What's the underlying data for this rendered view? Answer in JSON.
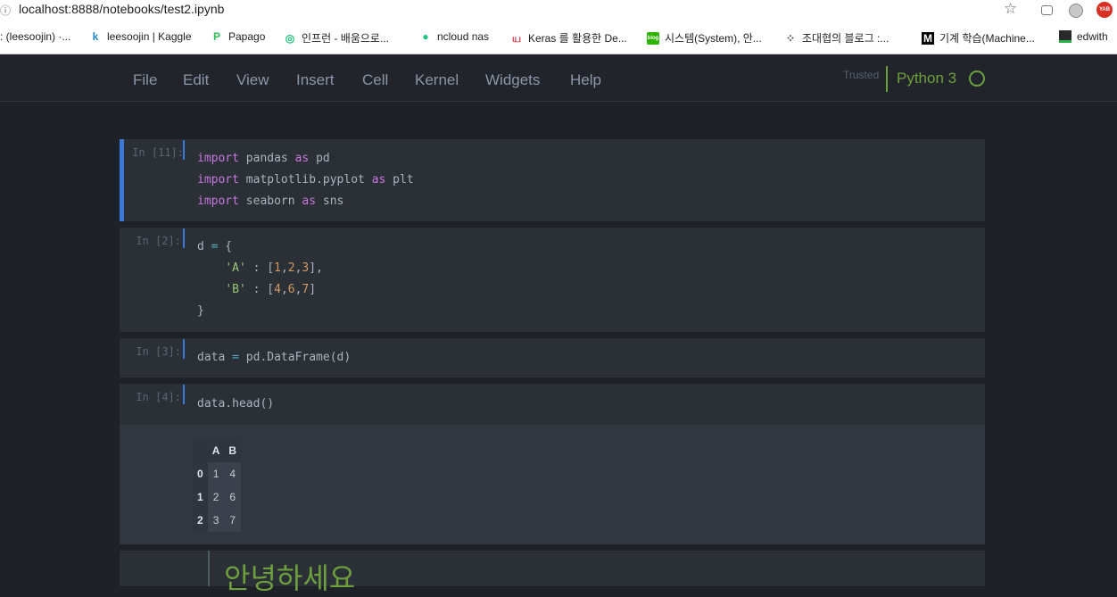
{
  "browser": {
    "url": "localhost:8888/notebooks/test2.ipynb",
    "bookmarks": [
      {
        "label": ": (leesoojin) ·..."
      },
      {
        "label": "leesoojin | Kaggle"
      },
      {
        "label": "Papago"
      },
      {
        "label": "인프런 - 배움으로..."
      },
      {
        "label": "ncloud nas"
      },
      {
        "label": "Keras 를 활용한 De..."
      },
      {
        "label": "시스템(System), 안..."
      },
      {
        "label": "조대협의 블로그 :..."
      },
      {
        "label": "기계 학습(Machine..."
      },
      {
        "label": "edwith"
      }
    ],
    "extension_badge": "YAB"
  },
  "menubar": {
    "items": [
      "File",
      "Edit",
      "View",
      "Insert",
      "Cell",
      "Kernel",
      "Widgets",
      "Help"
    ],
    "trusted": "Trusted",
    "kernel": "Python 3"
  },
  "cells": {
    "c1": {
      "prompt": "In [11]:",
      "l1": {
        "kw": "import",
        "a": " pandas ",
        "kw2": "as",
        "b": " pd"
      },
      "l2": {
        "kw": "import",
        "a": " matplotlib.pyplot ",
        "kw2": "as",
        "b": " plt"
      },
      "l3": {
        "kw": "import",
        "a": " seaborn ",
        "kw2": "as",
        "b": " sns"
      }
    },
    "c2": {
      "prompt": "In [2]:",
      "l1": {
        "a": "d ",
        "op": "=",
        "b": " {"
      },
      "l2": {
        "indent": "    ",
        "str": "'A'",
        "a": " : [",
        "n1": "1",
        "c1": ",",
        "n2": "2",
        "c2": ",",
        "n3": "3",
        "b": "],"
      },
      "l3": {
        "indent": "    ",
        "str": "'B'",
        "a": " : [",
        "n1": "4",
        "c1": ",",
        "n2": "6",
        "c2": ",",
        "n3": "7",
        "b": "]"
      },
      "l4": {
        "a": "}"
      }
    },
    "c3": {
      "prompt": "In [3]:",
      "l1": {
        "a": "data ",
        "op": "=",
        "b": " pd.DataFrame(d)"
      }
    },
    "c4": {
      "prompt": "In [4]:",
      "l1": {
        "a": "data.head()"
      }
    }
  },
  "output": {
    "columns": [
      "",
      "A",
      "B"
    ],
    "rows": [
      [
        "0",
        "1",
        "4"
      ],
      [
        "1",
        "2",
        "6"
      ],
      [
        "2",
        "3",
        "7"
      ]
    ]
  },
  "markdown": {
    "text": "안녕하세요"
  }
}
